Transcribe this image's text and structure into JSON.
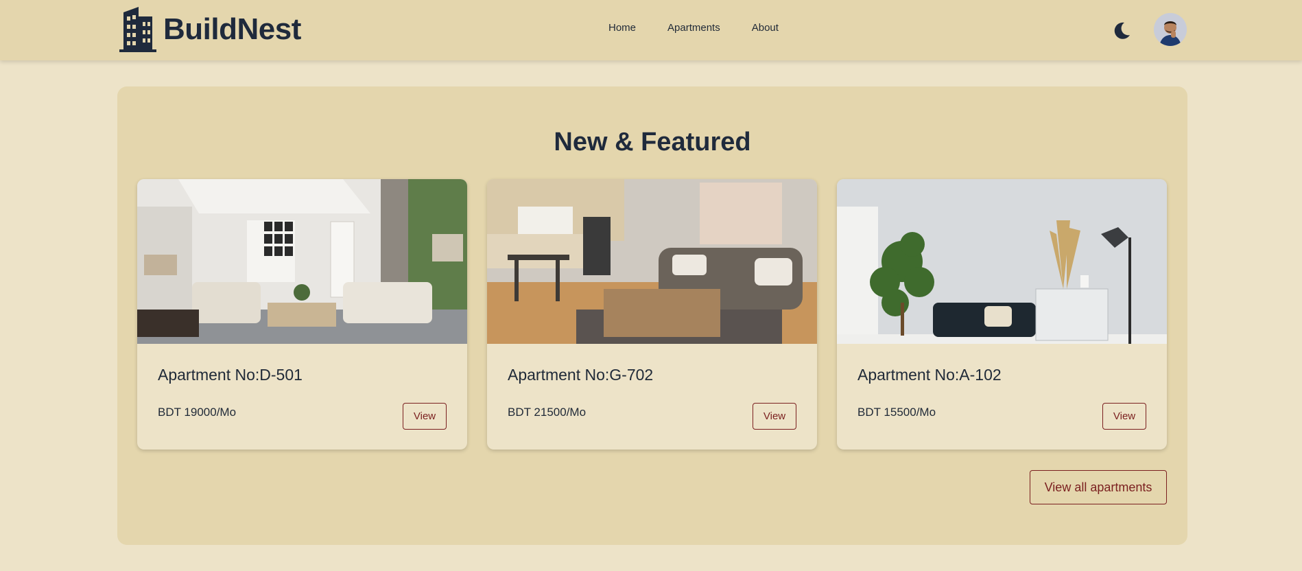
{
  "brand": {
    "name": "BuildNest",
    "icon": "building-icon"
  },
  "nav": {
    "items": [
      {
        "label": "Home"
      },
      {
        "label": "Apartments"
      },
      {
        "label": "About"
      }
    ]
  },
  "header": {
    "theme_icon": "moon-icon",
    "avatar_icon": "user-avatar"
  },
  "section": {
    "title": "New & Featured"
  },
  "apartments": [
    {
      "title": "Apartment No:D-501",
      "price": "BDT 19000/Mo",
      "view_label": "View"
    },
    {
      "title": "Apartment No:G-702",
      "price": "BDT 21500/Mo",
      "view_label": "View"
    },
    {
      "title": "Apartment No:A-102",
      "price": "BDT 15500/Mo",
      "view_label": "View"
    }
  ],
  "view_all_label": "View all apartments",
  "colors": {
    "navbar": "#e4d6ad",
    "page": "#ede3c8",
    "accent": "#7a1f1f",
    "heading": "#1f2a3c"
  }
}
